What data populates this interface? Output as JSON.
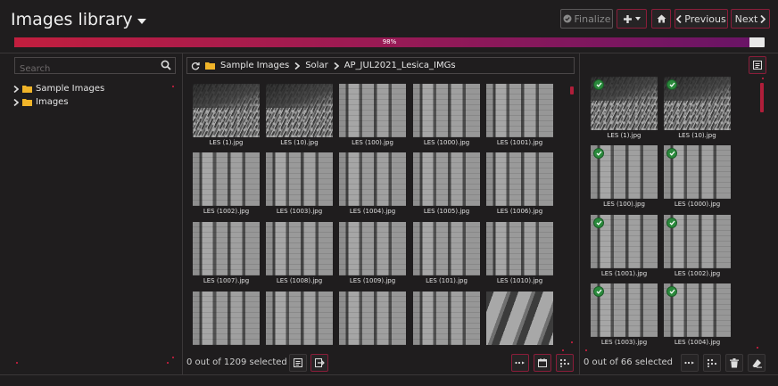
{
  "header": {
    "title": "Images library",
    "finalize_label": "Finalize",
    "previous_label": "Previous",
    "next_label": "Next"
  },
  "progress": {
    "label": "98%",
    "value": 0.98
  },
  "left_panel": {
    "search_placeholder": "Search",
    "tree": [
      {
        "label": "Sample Images"
      },
      {
        "label": "Images"
      }
    ]
  },
  "breadcrumb": [
    "Sample Images",
    "Solar",
    "AP_JUL2021_Lesica_IMGs"
  ],
  "grid": {
    "images": [
      "LES (1).jpg",
      "LES (10).jpg",
      "LES (100).jpg",
      "LES (1000).jpg",
      "LES (1001).jpg",
      "LES (1002).jpg",
      "LES (1003).jpg",
      "LES (1004).jpg",
      "LES (1005).jpg",
      "LES (1006).jpg",
      "LES (1007).jpg",
      "LES (1008).jpg",
      "LES (1009).jpg",
      "LES (101).jpg",
      "LES (1010).jpg",
      "",
      "",
      "",
      "",
      ""
    ],
    "footer_status": "0 out of 1209 selected"
  },
  "selected": {
    "images": [
      "LES (1).jpg",
      "LES (10).jpg",
      "LES (100).jpg",
      "LES (1000).jpg",
      "LES (1001).jpg",
      "LES (1002).jpg",
      "LES (1003).jpg",
      "LES (1004).jpg"
    ],
    "footer_status": "0 out of 66 selected"
  },
  "colors": {
    "accent": "#b01e3a",
    "background": "#1f1d1e",
    "check": "#2a8a3c"
  }
}
